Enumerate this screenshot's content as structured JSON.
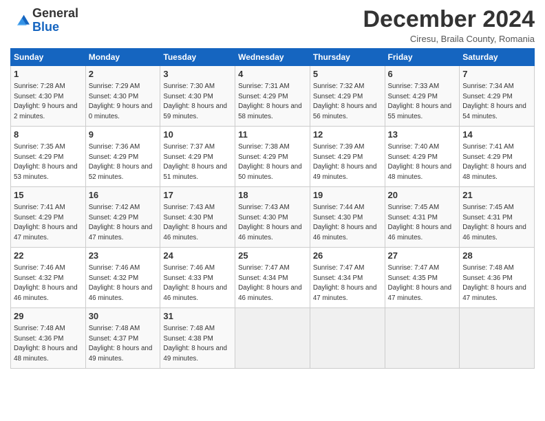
{
  "header": {
    "logo_general": "General",
    "logo_blue": "Blue",
    "month_title": "December 2024",
    "location": "Ciresu, Braila County, Romania"
  },
  "days_of_week": [
    "Sunday",
    "Monday",
    "Tuesday",
    "Wednesday",
    "Thursday",
    "Friday",
    "Saturday"
  ],
  "weeks": [
    [
      {
        "day": "1",
        "rise": "7:28 AM",
        "set": "4:30 PM",
        "daylight": "9 hours and 2 minutes."
      },
      {
        "day": "2",
        "rise": "7:29 AM",
        "set": "4:30 PM",
        "daylight": "9 hours and 0 minutes."
      },
      {
        "day": "3",
        "rise": "7:30 AM",
        "set": "4:30 PM",
        "daylight": "8 hours and 59 minutes."
      },
      {
        "day": "4",
        "rise": "7:31 AM",
        "set": "4:29 PM",
        "daylight": "8 hours and 58 minutes."
      },
      {
        "day": "5",
        "rise": "7:32 AM",
        "set": "4:29 PM",
        "daylight": "8 hours and 56 minutes."
      },
      {
        "day": "6",
        "rise": "7:33 AM",
        "set": "4:29 PM",
        "daylight": "8 hours and 55 minutes."
      },
      {
        "day": "7",
        "rise": "7:34 AM",
        "set": "4:29 PM",
        "daylight": "8 hours and 54 minutes."
      }
    ],
    [
      {
        "day": "8",
        "rise": "7:35 AM",
        "set": "4:29 PM",
        "daylight": "8 hours and 53 minutes."
      },
      {
        "day": "9",
        "rise": "7:36 AM",
        "set": "4:29 PM",
        "daylight": "8 hours and 52 minutes."
      },
      {
        "day": "10",
        "rise": "7:37 AM",
        "set": "4:29 PM",
        "daylight": "8 hours and 51 minutes."
      },
      {
        "day": "11",
        "rise": "7:38 AM",
        "set": "4:29 PM",
        "daylight": "8 hours and 50 minutes."
      },
      {
        "day": "12",
        "rise": "7:39 AM",
        "set": "4:29 PM",
        "daylight": "8 hours and 49 minutes."
      },
      {
        "day": "13",
        "rise": "7:40 AM",
        "set": "4:29 PM",
        "daylight": "8 hours and 48 minutes."
      },
      {
        "day": "14",
        "rise": "7:41 AM",
        "set": "4:29 PM",
        "daylight": "8 hours and 48 minutes."
      }
    ],
    [
      {
        "day": "15",
        "rise": "7:41 AM",
        "set": "4:29 PM",
        "daylight": "8 hours and 47 minutes."
      },
      {
        "day": "16",
        "rise": "7:42 AM",
        "set": "4:29 PM",
        "daylight": "8 hours and 47 minutes."
      },
      {
        "day": "17",
        "rise": "7:43 AM",
        "set": "4:30 PM",
        "daylight": "8 hours and 46 minutes."
      },
      {
        "day": "18",
        "rise": "7:43 AM",
        "set": "4:30 PM",
        "daylight": "8 hours and 46 minutes."
      },
      {
        "day": "19",
        "rise": "7:44 AM",
        "set": "4:30 PM",
        "daylight": "8 hours and 46 minutes."
      },
      {
        "day": "20",
        "rise": "7:45 AM",
        "set": "4:31 PM",
        "daylight": "8 hours and 46 minutes."
      },
      {
        "day": "21",
        "rise": "7:45 AM",
        "set": "4:31 PM",
        "daylight": "8 hours and 46 minutes."
      }
    ],
    [
      {
        "day": "22",
        "rise": "7:46 AM",
        "set": "4:32 PM",
        "daylight": "8 hours and 46 minutes."
      },
      {
        "day": "23",
        "rise": "7:46 AM",
        "set": "4:32 PM",
        "daylight": "8 hours and 46 minutes."
      },
      {
        "day": "24",
        "rise": "7:46 AM",
        "set": "4:33 PM",
        "daylight": "8 hours and 46 minutes."
      },
      {
        "day": "25",
        "rise": "7:47 AM",
        "set": "4:34 PM",
        "daylight": "8 hours and 46 minutes."
      },
      {
        "day": "26",
        "rise": "7:47 AM",
        "set": "4:34 PM",
        "daylight": "8 hours and 47 minutes."
      },
      {
        "day": "27",
        "rise": "7:47 AM",
        "set": "4:35 PM",
        "daylight": "8 hours and 47 minutes."
      },
      {
        "day": "28",
        "rise": "7:48 AM",
        "set": "4:36 PM",
        "daylight": "8 hours and 47 minutes."
      }
    ],
    [
      {
        "day": "29",
        "rise": "7:48 AM",
        "set": "4:36 PM",
        "daylight": "8 hours and 48 minutes."
      },
      {
        "day": "30",
        "rise": "7:48 AM",
        "set": "4:37 PM",
        "daylight": "8 hours and 49 minutes."
      },
      {
        "day": "31",
        "rise": "7:48 AM",
        "set": "4:38 PM",
        "daylight": "8 hours and 49 minutes."
      },
      null,
      null,
      null,
      null
    ]
  ]
}
